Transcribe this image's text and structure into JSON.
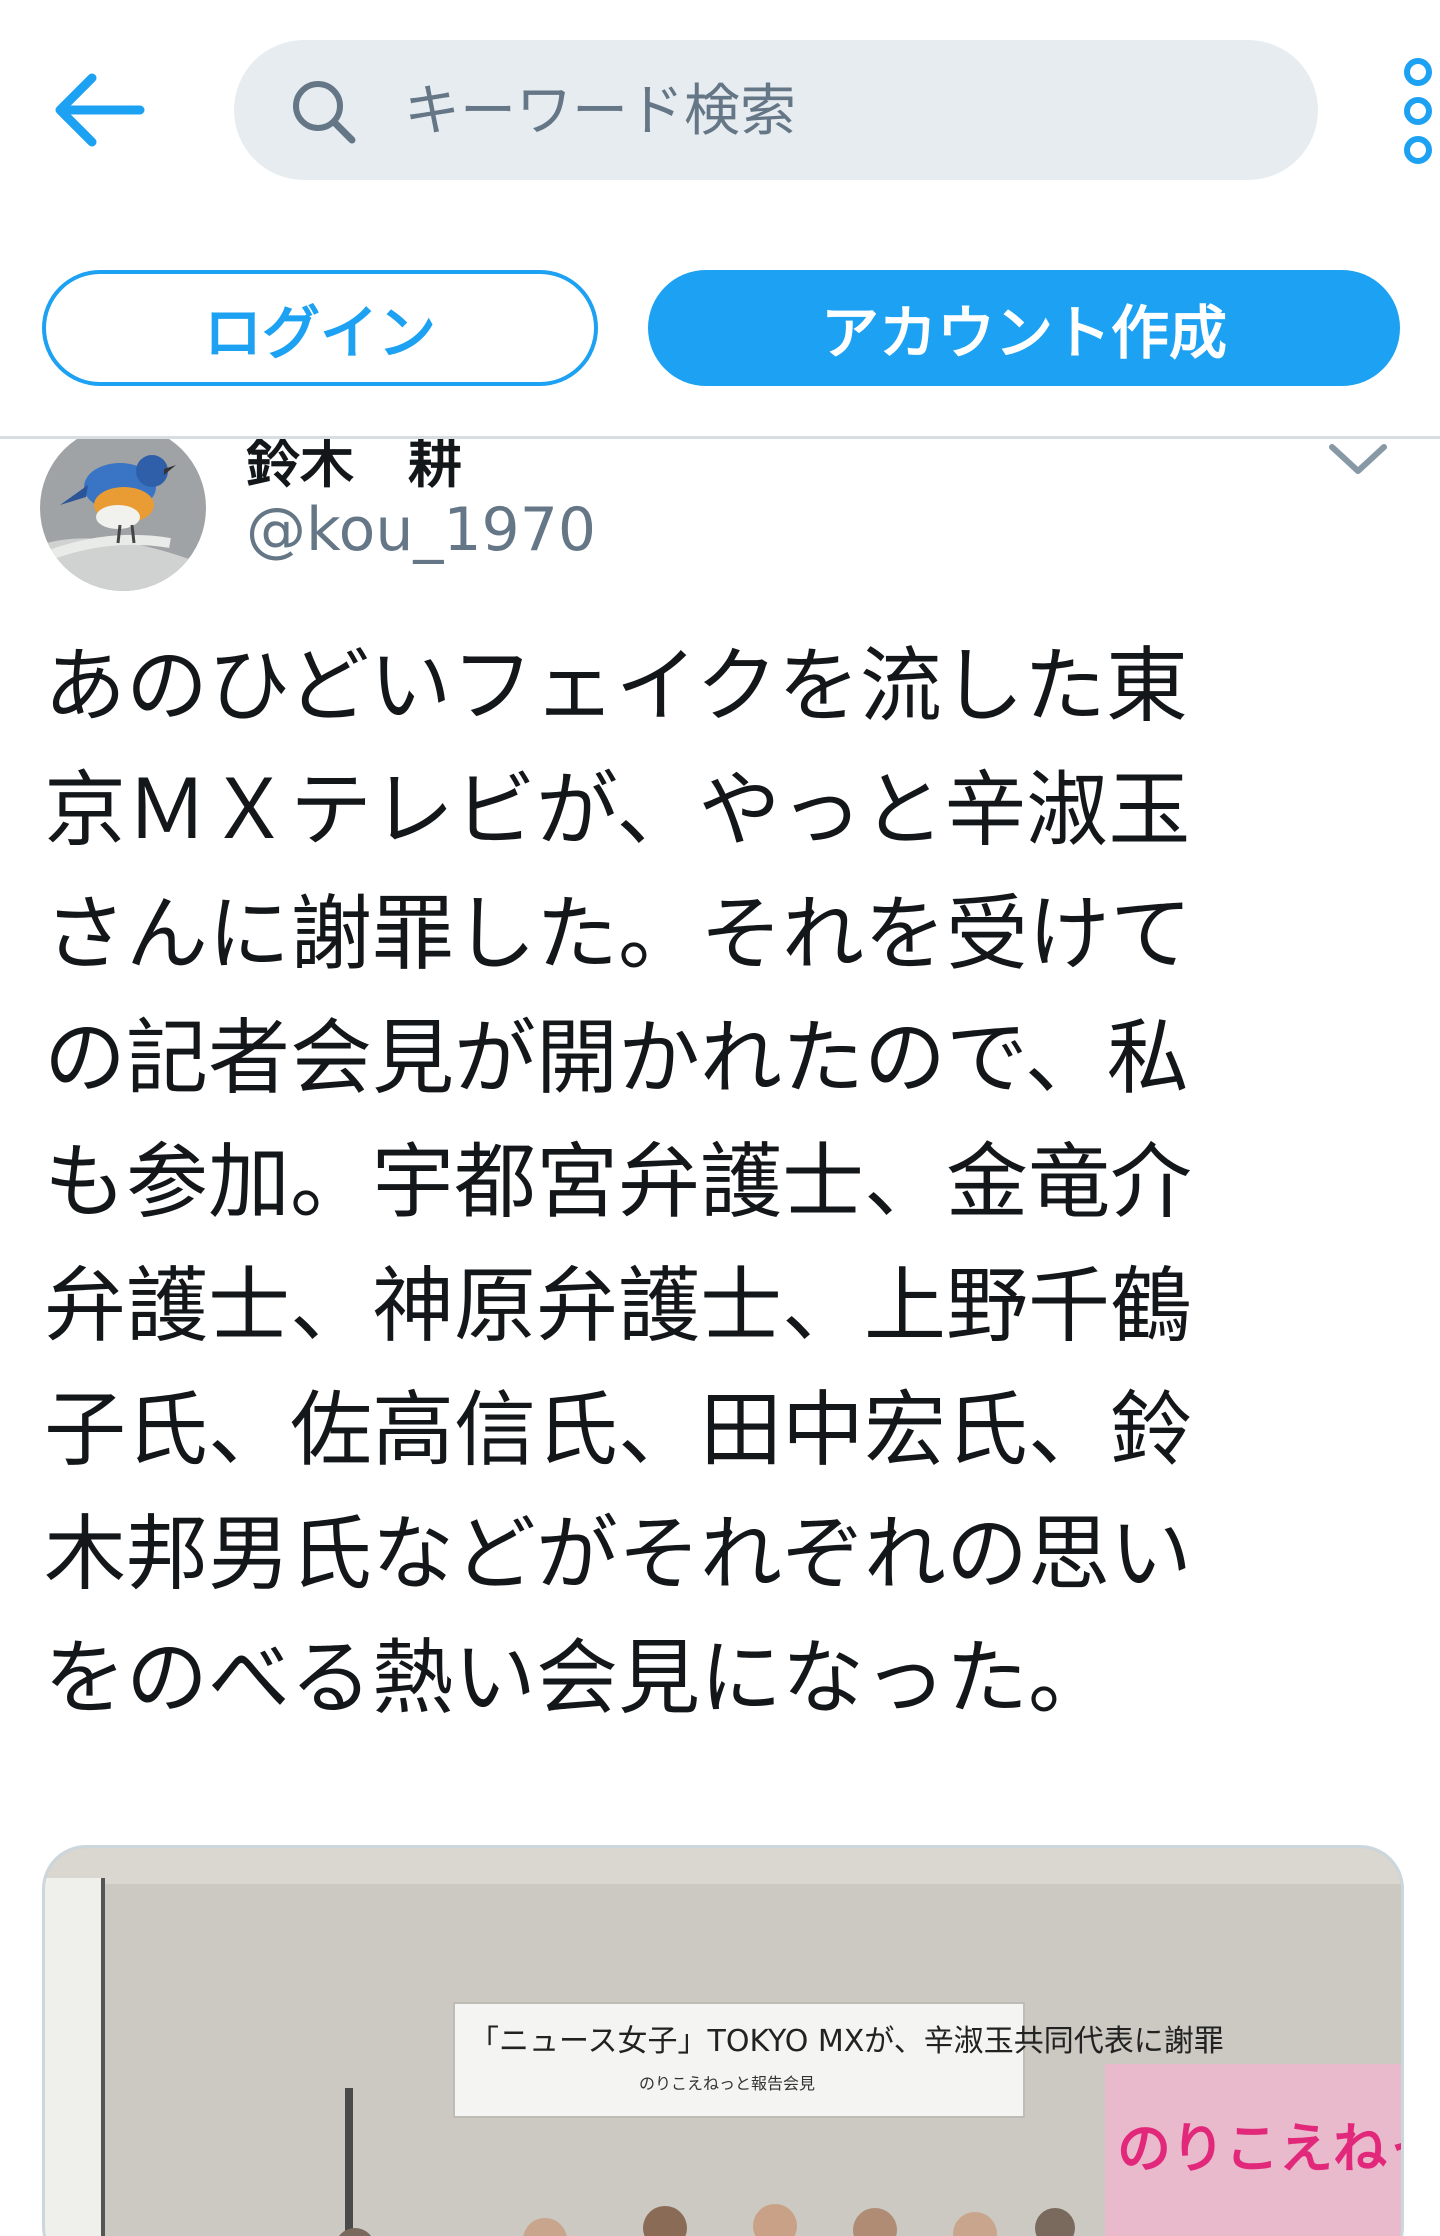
{
  "header": {
    "search_placeholder": "キーワード検索"
  },
  "auth": {
    "login_label": "ログイン",
    "signup_label": "アカウント作成"
  },
  "tweet": {
    "display_name": "鈴木　耕",
    "handle": "@kou_1970",
    "text_lines": [
      "あのひどいフェイクを流した東",
      "京ＭＸテレビが、やっと辛淑玉",
      "さんに謝罪した。それを受けて",
      "の記者会見が開かれたので、私",
      "も参加。宇都宮弁護士、金竜介",
      "弁護士、神原弁護士、上野千鶴",
      "子氏、佐高信氏、田中宏氏、鈴",
      "木邦男氏などがそれぞれの思い",
      "をのべる熱い会見になった。"
    ],
    "media": {
      "banner_title": "「ニュース女子」TOKYO MXが、辛淑玉共同代表に謝罪",
      "banner_sub": "のりこえねっと報告会見",
      "sign_text": "のりこえねっと"
    }
  },
  "colors": {
    "accent": "#1da1f2",
    "search_bg": "#e6ecf0",
    "muted": "#657786"
  }
}
